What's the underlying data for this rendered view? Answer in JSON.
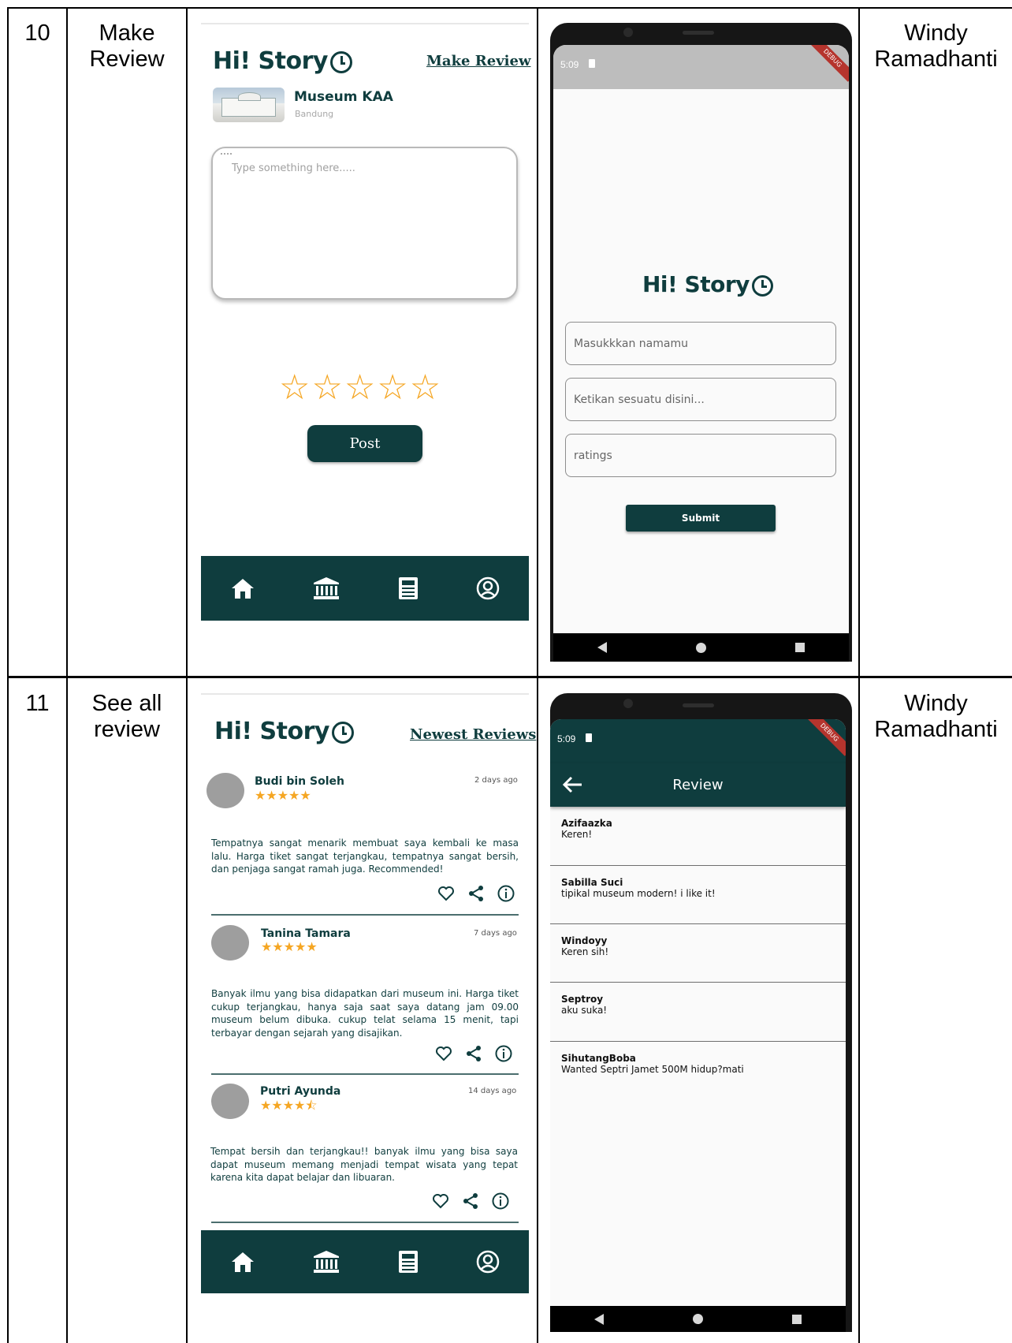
{
  "rows": [
    {
      "number": "10",
      "feature_line1": "Make",
      "feature_line2": "Review",
      "author_line1": "Windy",
      "author_line2": "Ramadhanti",
      "design": {
        "logo": "Hi! Story",
        "header_link": "Make Review",
        "museum_name": "Museum KAA",
        "museum_city": "Bandung",
        "textarea_placeholder": "Type something here.....",
        "rating_stars": "☆☆☆☆☆",
        "post_label": "Post",
        "nav_icons": [
          "home-icon",
          "museum-icon",
          "news-icon",
          "profile-icon"
        ]
      },
      "app": {
        "status_time": "5:09",
        "debug_banner": "DEBUG",
        "logo": "Hi! Story",
        "name_placeholder": "Masukkkan namamu",
        "comment_placeholder": "Ketikan sesuatu disini...",
        "ratings_placeholder": "ratings",
        "submit_label": "Submit"
      }
    },
    {
      "number": "11",
      "feature_line1": "See all",
      "feature_line2": "review",
      "author_line1": "Windy",
      "author_line2": "Ramadhanti",
      "design": {
        "logo": "Hi! Story",
        "header_link": "Newest Reviews",
        "reviews": [
          {
            "name": "Budi bin Soleh",
            "stars": "★★★★★",
            "date": "2 days ago",
            "text": "Tempatnya sangat menarik membuat saya kembali ke masa lalu. Harga tiket sangat terjangkau, tempatnya sangat bersih, dan penjaga sangat ramah juga. Recommended!"
          },
          {
            "name": "Tanina Tamara",
            "stars": "★★★★★",
            "date": "7 days ago",
            "text": "Banyak ilmu yang bisa didapatkan dari museum ini. Harga tiket cukup terjangkau, hanya saja saat saya datang jam 09.00 museum belum dibuka. cukup telat selama 15 menit, tapi terbayar dengan sejarah yang disajikan."
          },
          {
            "name": "Putri Ayunda",
            "stars": "★★★★⯪",
            "date": "14 days ago",
            "text": "Tempat bersih dan terjangkau!! banyak ilmu yang bisa saya dapat museum memang menjadi tempat wisata yang tepat karena kita dapat belajar dan libuaran."
          }
        ],
        "nav_icons": [
          "home-icon",
          "museum-icon",
          "news-icon",
          "profile-icon"
        ]
      },
      "app": {
        "status_time": "5:09",
        "debug_banner": "DEBUG",
        "appbar_title": "Review",
        "items": [
          {
            "name": "Azifaazka",
            "text": "Keren!"
          },
          {
            "name": "Sabilla Suci",
            "text": "tipikal museum modern! i like it!"
          },
          {
            "name": "Windoyy",
            "text": "Keren sih!"
          },
          {
            "name": "Septroy",
            "text": "aku suka!"
          },
          {
            "name": "SihutangBoba",
            "text": "Wanted Septri Jamet 500M hidup?mati"
          }
        ]
      }
    }
  ],
  "colors": {
    "brand_green": "#0f3d3e",
    "star_gold": "#f5a623",
    "status_gray": "#bdbdbd"
  }
}
